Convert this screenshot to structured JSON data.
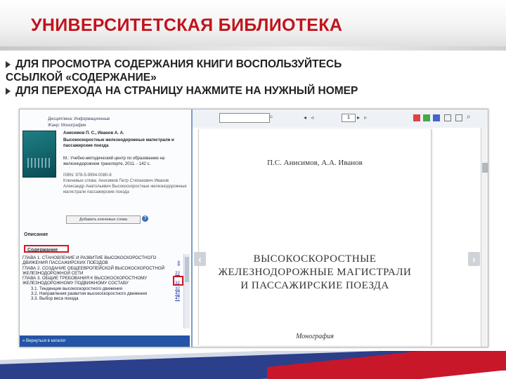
{
  "slide": {
    "title": "УНИВЕРСИТЕТСКАЯ БИБЛИОТЕКА",
    "bullet1_line1": "ДЛЯ ПРОСМОТРА СОДЕРЖАНИЯ КНИГИ ВОСПОЛЬЗУЙТЕСЬ",
    "bullet1_line2": "ССЫЛКОЙ «СОДЕРЖАНИЕ»",
    "bullet2": "ДЛЯ ПЕРЕХОДА НА СТРАНИЦУ НАЖМИТЕ НА НУЖНЫЙ НОМЕР"
  },
  "sidebar": {
    "discipline_label": "Дисциплина: Информационные",
    "type_label": "Жанр: Монографии",
    "authors": "Анисимов П. С., Иванов А. А.",
    "book_title": "Высокоскоростные железнодорожные магистрали и пассажирские поезда",
    "publisher": "М.: Учебно-методический центр по образованию на железнодорожном транспорте, 2011. - 142 с.",
    "isbn": "ISBN: 978-5-9994-0080-8",
    "keywords": "Ключевые слова: Анисимов Петр Степанович Иванов Александр Анатольевич Высокоскоростные железнодорожные магистрали пассажирские поезда",
    "add_button": "Добавить ключевые слова",
    "description": "Описание",
    "contents_link": "Содержание",
    "toc": [
      {
        "text": "Глава 1. СТАНОВЛЕНИЕ И РАЗВИТИЕ ВЫСОКОСКОРОСТНОГО ДВИЖЕНИЯ ПАССАЖИРСКИХ ПОЕЗДОВ",
        "page": "8",
        "sub": false
      },
      {
        "text": "Глава 2. СОЗДАНИЕ ОБЩЕЕВРОПЕЙСКОЙ ВЫСОКОСКОРОСТНОЙ ЖЕЛЕЗНОДОРОЖНОЙ СЕТИ",
        "page": "22",
        "sub": false
      },
      {
        "text": "Глава 3. ОБЩИЕ ТРЕБОВАНИЯ К ВЫСОКОСКОРОСТНОМУ ЖЕЛЕЗНОДОРОЖНОМУ ПОДВИЖНОМУ СОСТАВУ",
        "page": "32",
        "sub": false
      },
      {
        "text": "3.1. Тенденции высокоскоростного движения",
        "page": "32",
        "sub": true
      },
      {
        "text": "3.2. Направления развития высокоскоростного движения",
        "page": "42",
        "sub": true
      },
      {
        "text": "3.3. Выбор веса поезда",
        "page": "47",
        "sub": true
      }
    ],
    "footer": "« Вернуться в каталог"
  },
  "viewer": {
    "page_number": "1",
    "doc_authors": "П.С. Анисимов, А.А. Иванов",
    "doc_title_line1": "ВЫСОКОСКОРОСТНЫЕ",
    "doc_title_line2": "ЖЕЛЕЗНОДОРОЖНЫЕ МАГИСТРАЛИ",
    "doc_title_line3": "И ПАССАЖИРСКИЕ ПОЕЗДА",
    "doc_type": "Монография",
    "prev_arrow": "‹",
    "next_arrow": "›"
  },
  "colors": {
    "title_red": "#c0141c",
    "highlight_red": "#d01822",
    "footer_blue": "#2454a6"
  }
}
